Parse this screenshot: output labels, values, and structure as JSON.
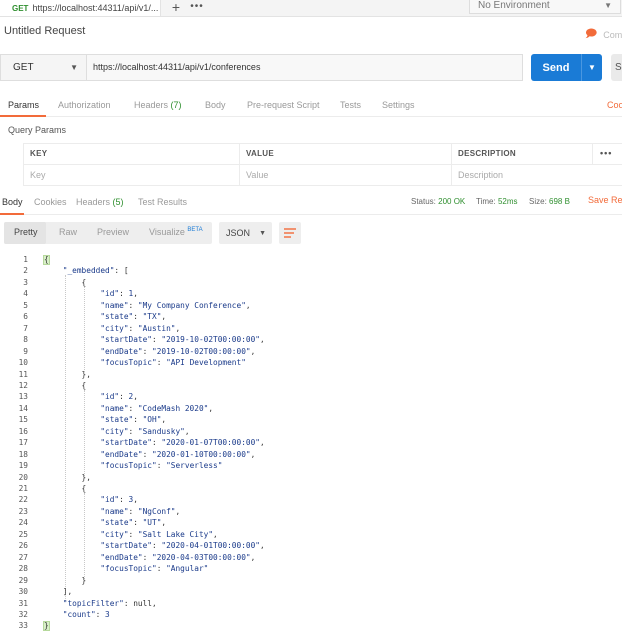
{
  "tab": {
    "method": "GET",
    "url": "https://localhost:44311/api/v1/..."
  },
  "environment": {
    "label": "No Environment"
  },
  "request": {
    "title": "Untitled Request",
    "comments_label": "Comm",
    "method": "GET",
    "url": "https://localhost:44311/api/v1/conferences",
    "send_label": "Send",
    "save_label": "Sa"
  },
  "request_tabs": {
    "params": "Params",
    "authorization": "Authorization",
    "headers": "Headers",
    "headers_count": "(7)",
    "body": "Body",
    "prerequest": "Pre-request Script",
    "tests": "Tests",
    "settings": "Settings",
    "cookies": "Cook"
  },
  "query_params": {
    "label": "Query Params",
    "columns": [
      "KEY",
      "VALUE",
      "DESCRIPTION"
    ],
    "bulk_edit": "•••",
    "placeholders": [
      "Key",
      "Value",
      "Description"
    ]
  },
  "response_tabs": {
    "body": "Body",
    "cookies": "Cookies",
    "headers": "Headers",
    "headers_count": "(5)",
    "test_results": "Test Results"
  },
  "response_status": {
    "status_label": "Status:",
    "status_value": "200 OK",
    "time_label": "Time:",
    "time_value": "52ms",
    "size_label": "Size:",
    "size_value": "698 B",
    "save_response": "Save Res"
  },
  "format": {
    "pretty": "Pretty",
    "raw": "Raw",
    "preview": "Preview",
    "visualize": "Visualize",
    "beta": "BETA",
    "language": "JSON"
  },
  "code_lines": [
    "{",
    "    \"_embedded\": [",
    "        {",
    "            \"id\": 1,",
    "            \"name\": \"My Company Conference\",",
    "            \"state\": \"TX\",",
    "            \"city\": \"Austin\",",
    "            \"startDate\": \"2019-10-02T00:00:00\",",
    "            \"endDate\": \"2019-10-02T00:00:00\",",
    "            \"focusTopic\": \"API Development\"",
    "        },",
    "        {",
    "            \"id\": 2,",
    "            \"name\": \"CodeMash 2020\",",
    "            \"state\": \"OH\",",
    "            \"city\": \"Sandusky\",",
    "            \"startDate\": \"2020-01-07T00:00:00\",",
    "            \"endDate\": \"2020-01-10T00:00:00\",",
    "            \"focusTopic\": \"Serverless\"",
    "        },",
    "        {",
    "            \"id\": 3,",
    "            \"name\": \"NgConf\",",
    "            \"state\": \"UT\",",
    "            \"city\": \"Salt Lake City\",",
    "            \"startDate\": \"2020-04-01T00:00:00\",",
    "            \"endDate\": \"2020-04-03T00:00:00\",",
    "            \"focusTopic\": \"Angular\"",
    "        }",
    "    ],",
    "    \"topicFilter\": null,",
    "    \"count\": 3",
    "}"
  ]
}
